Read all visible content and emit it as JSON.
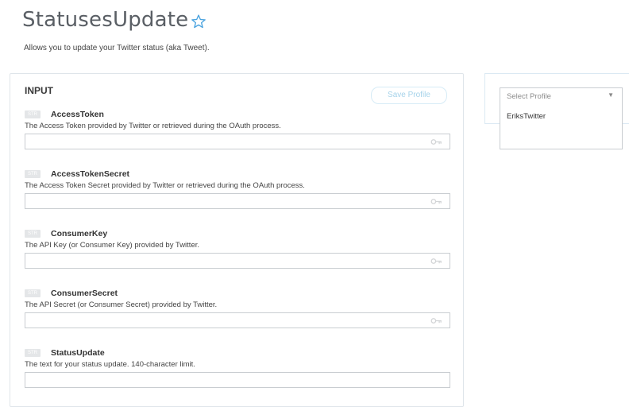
{
  "header": {
    "title": "StatusesUpdate",
    "description": "Allows you to update your Twitter status (aka Tweet)."
  },
  "input_panel": {
    "heading": "INPUT",
    "save_profile_label": "Save Profile",
    "fields": [
      {
        "badge": "STR",
        "name": "AccessToken",
        "description": "The Access Token provided by Twitter or retrieved during the OAuth process.",
        "value": "",
        "icon": "key-icon"
      },
      {
        "badge": "STR",
        "name": "AccessTokenSecret",
        "description": "The Access Token Secret provided by Twitter or retrieved during the OAuth process.",
        "value": "",
        "icon": "key-icon"
      },
      {
        "badge": "STR",
        "name": "ConsumerKey",
        "description": "The API Key (or Consumer Key) provided by Twitter.",
        "value": "",
        "icon": "key-icon"
      },
      {
        "badge": "STR",
        "name": "ConsumerSecret",
        "description": "The API Secret (or Consumer Secret) provided by Twitter.",
        "value": "",
        "icon": "key-icon"
      },
      {
        "badge": "STR",
        "name": "StatusUpdate",
        "description": "The text for your status update. 140-character limit.",
        "value": ""
      }
    ]
  },
  "profile": {
    "select_placeholder": "Select Profile",
    "options": [
      "EriksTwitter"
    ]
  },
  "colors": {
    "title": "#5a5f65",
    "accent": "#4aa3df",
    "badge": "#e4e6e8",
    "border": "#c9cdd1"
  }
}
